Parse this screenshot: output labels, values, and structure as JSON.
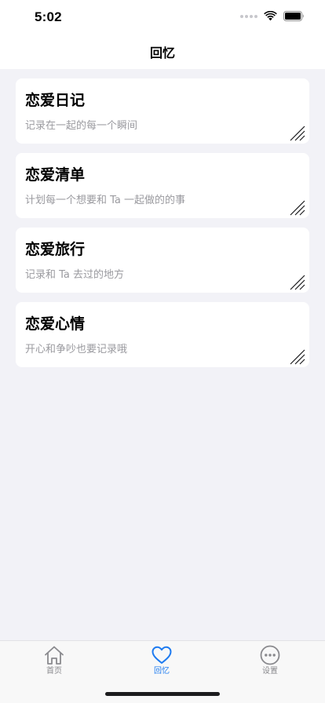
{
  "status_bar": {
    "time": "5:02"
  },
  "nav": {
    "title": "回忆"
  },
  "cards": [
    {
      "title": "恋爱日记",
      "subtitle": "记录在一起的每一个瞬间"
    },
    {
      "title": "恋爱清单",
      "subtitle": "计划每一个想要和 Ta 一起做的的事"
    },
    {
      "title": "恋爱旅行",
      "subtitle": "记录和 Ta 去过的地方"
    },
    {
      "title": "恋爱心情",
      "subtitle": "开心和争吵也要记录哦"
    }
  ],
  "tabs": [
    {
      "label": "首页",
      "icon": "home-icon",
      "active": false
    },
    {
      "label": "回忆",
      "icon": "heart-icon",
      "active": true
    },
    {
      "label": "设置",
      "icon": "more-icon",
      "active": false
    }
  ],
  "colors": {
    "accent": "#1e7bf0",
    "inactive": "#8a8a8e",
    "subtitle": "#9a9a9f",
    "background": "#f2f2f7"
  }
}
